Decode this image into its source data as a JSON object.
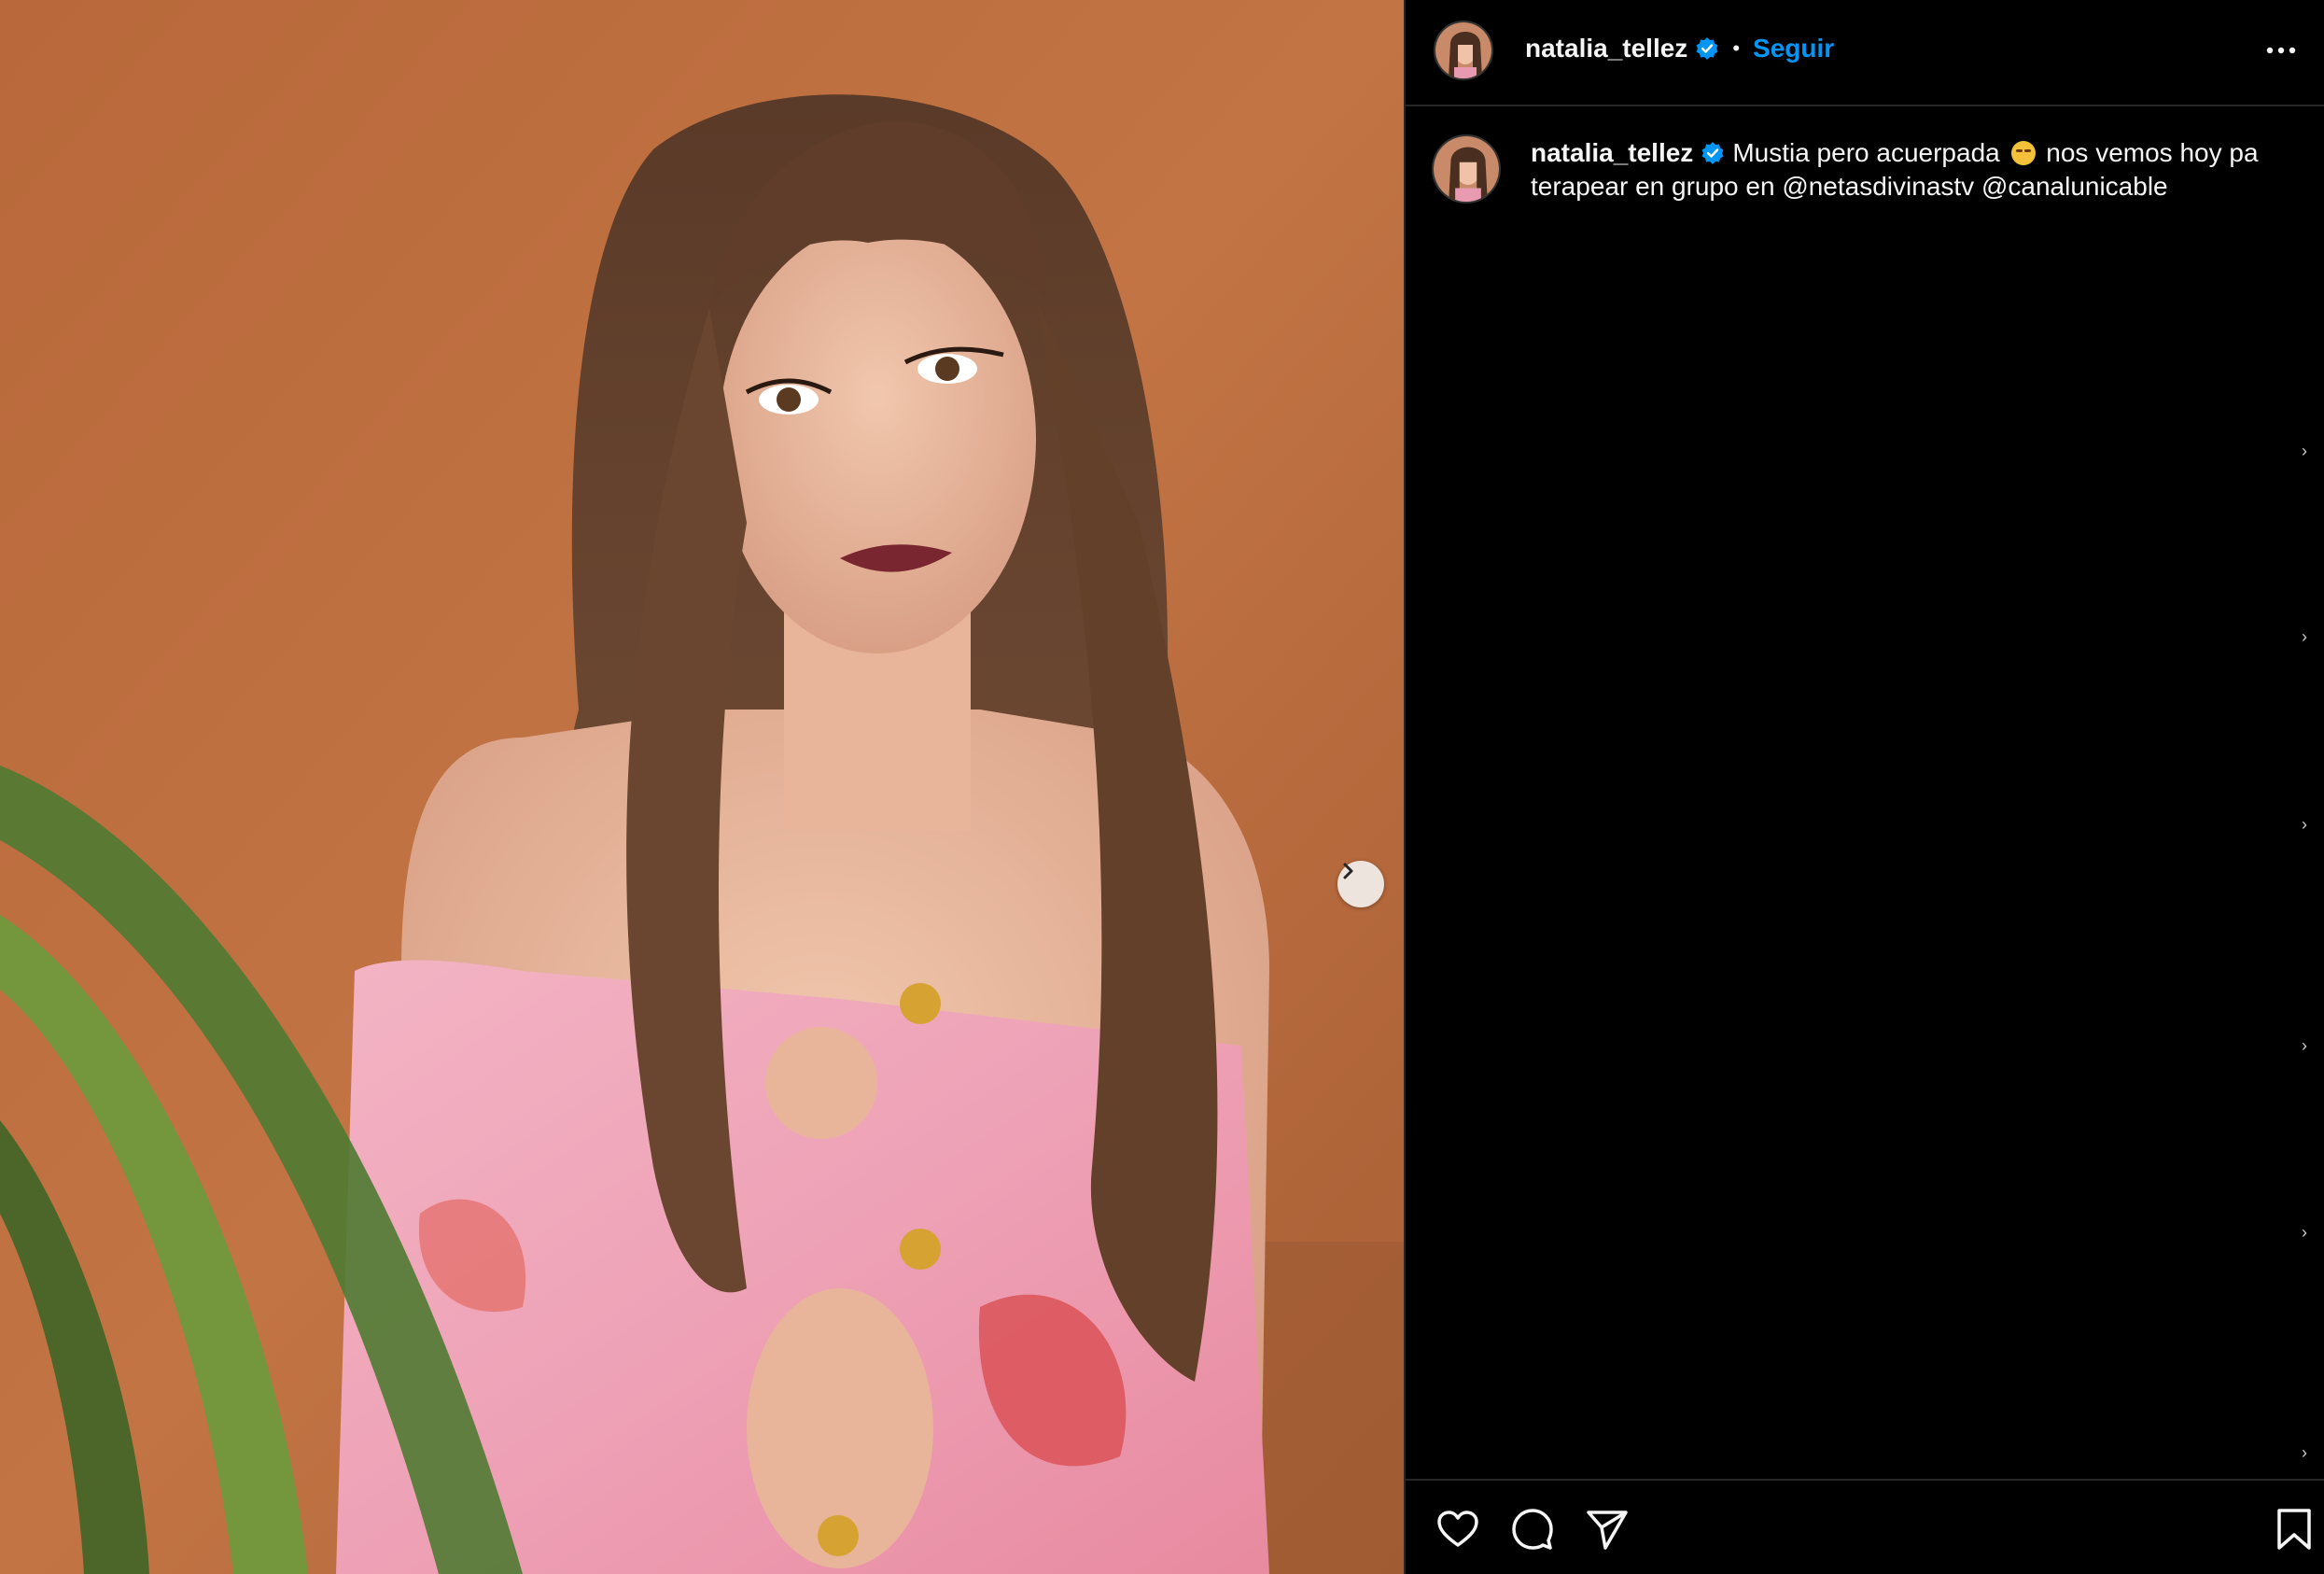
{
  "post": {
    "author": {
      "username": "natalia_tellez",
      "verified": true,
      "avatar_icon": "profile-avatar"
    },
    "header": {
      "separator": "•",
      "follow_label": "Seguir",
      "more_icon": "more-horizontal-icon"
    },
    "caption": {
      "username": "natalia_tellez",
      "text_before_emoji": "Mustia pero acuerpada",
      "emoji_name": "relieved-face-emoji",
      "text_after_emoji": "nos vemos hoy pa terapear en grupo en",
      "mentions": [
        "@netasdivinastv",
        "@canalunicable"
      ]
    },
    "media": {
      "next_icon": "chevron-right-icon"
    },
    "actions": {
      "like_icon": "heart-icon",
      "comment_icon": "comment-icon",
      "share_icon": "send-icon",
      "save_icon": "bookmark-icon"
    },
    "colors": {
      "accent": "#0095f6",
      "background": "#000000",
      "text": "#f5f5f5",
      "divider": "#262626"
    }
  }
}
